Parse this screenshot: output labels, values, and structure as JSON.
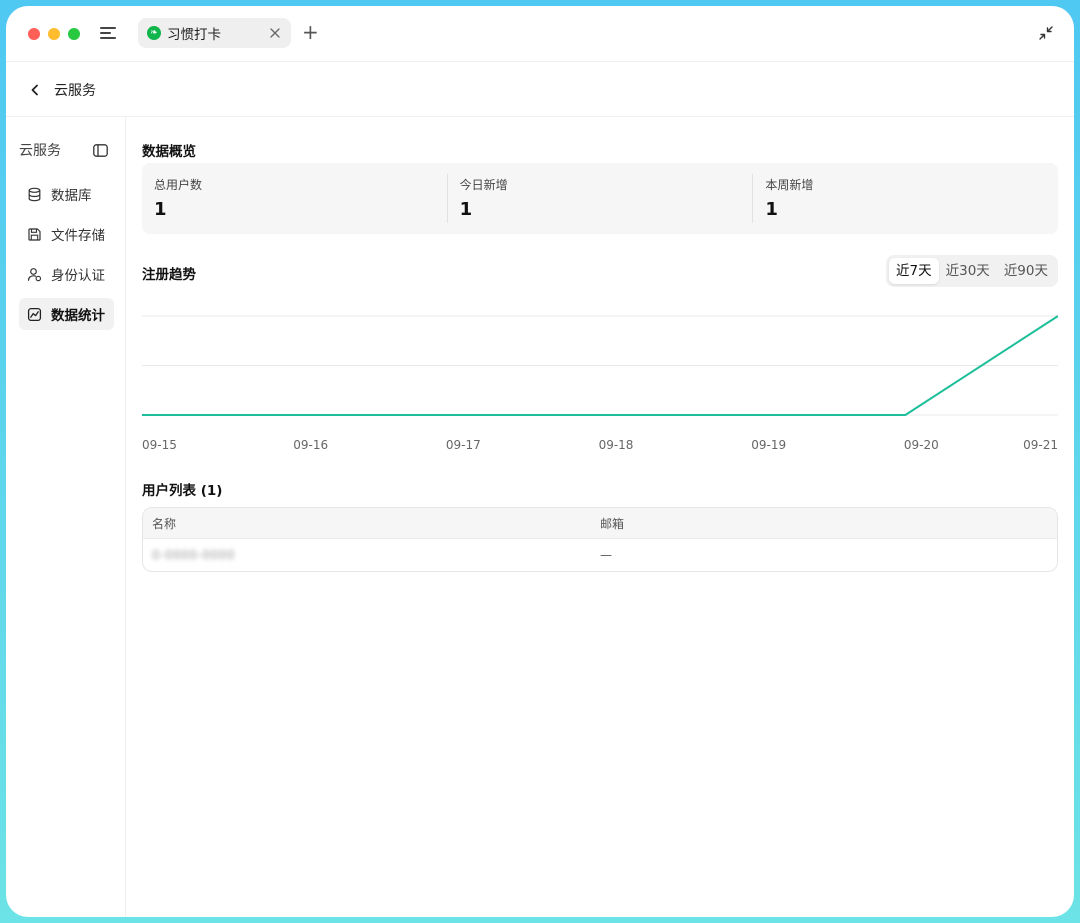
{
  "window": {
    "tab_label": "习惯打卡",
    "tab_icon": "mini-program-icon",
    "new_tab_glyph": "+"
  },
  "header": {
    "title": "云服务"
  },
  "sidebar": {
    "title": "云服务",
    "items": [
      {
        "label": "数据库",
        "icon": "database-icon",
        "active": false
      },
      {
        "label": "文件存储",
        "icon": "save-disk-icon",
        "active": false
      },
      {
        "label": "身份认证",
        "icon": "user-auth-icon",
        "active": false
      },
      {
        "label": "数据统计",
        "icon": "chart-icon",
        "active": true
      }
    ]
  },
  "overview": {
    "title": "数据概览",
    "stats": [
      {
        "label": "总用户数",
        "value": "1"
      },
      {
        "label": "今日新增",
        "value": "1"
      },
      {
        "label": "本周新增",
        "value": "1"
      }
    ]
  },
  "trend": {
    "title": "注册趋势",
    "ranges": [
      "近7天",
      "近30天",
      "近90天"
    ],
    "selected_range": "近7天"
  },
  "chart_data": {
    "type": "line",
    "title": "注册趋势",
    "categories": [
      "09-15",
      "09-16",
      "09-17",
      "09-18",
      "09-19",
      "09-20",
      "09-21"
    ],
    "series": [
      {
        "values": [
          0,
          0,
          0,
          0,
          0,
          0,
          1
        ]
      }
    ],
    "ylim": [
      0,
      1
    ],
    "grid": true,
    "line_color": "#1dbf9a"
  },
  "users": {
    "title": "用户列表 (1)",
    "columns": [
      "名称",
      "邮箱"
    ],
    "rows": [
      {
        "name": "0-0000-0000",
        "email": "—"
      }
    ]
  }
}
